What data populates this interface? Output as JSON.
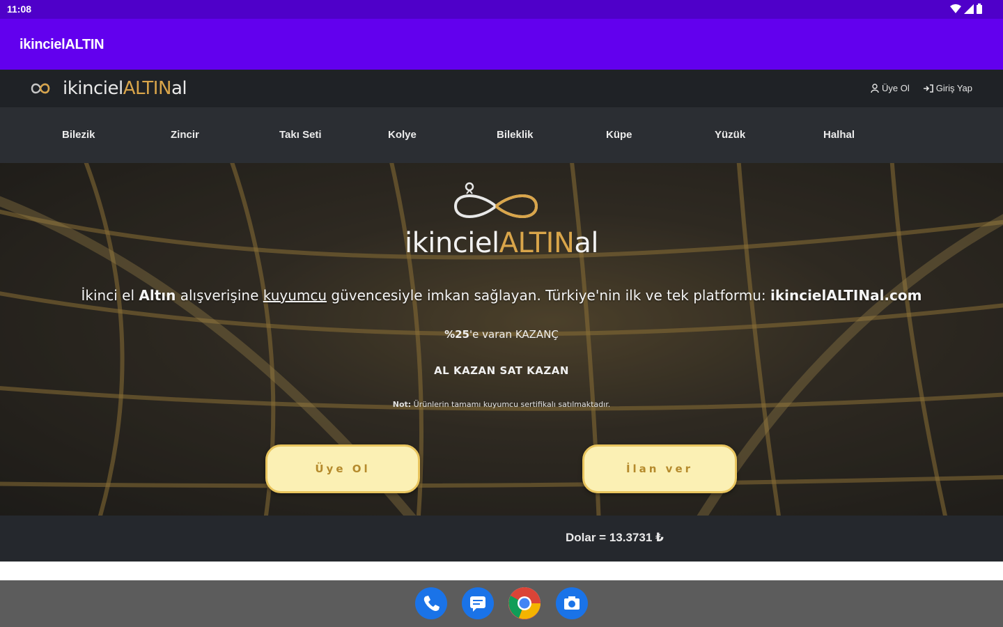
{
  "status_bar": {
    "time": "11:08"
  },
  "app_bar": {
    "title": "ikincielALTIN"
  },
  "site": {
    "logo": {
      "part1": "ikinciel",
      "part2": "ALTIN",
      "part3": "al"
    },
    "header_links": {
      "register": "Üye Ol",
      "login": "Giriş Yap"
    },
    "categories": [
      "Bilezik",
      "Zincir",
      "Takı Seti",
      "Kolye",
      "Bileklik",
      "Küpe",
      "Yüzük",
      "Halhal"
    ]
  },
  "hero": {
    "logo": {
      "part1": "ikinciel",
      "part2": "ALTIN",
      "part3": "al"
    },
    "headline": {
      "t1": "İkinci el ",
      "t2": "Altın",
      "t3": " alışverişine ",
      "t4": "kuyumcu",
      "t5": " güvencesiyle imkan sağlayan. Türkiye'nin ilk ve tek platformu: ",
      "t6": "ikincielALTINal.com"
    },
    "gain": {
      "bold": "%25",
      "rest": "'e varan KAZANÇ"
    },
    "slogan": "AL KAZAN SAT KAZAN",
    "note": {
      "label": "Not:",
      "text": " Ürünlerin tamamı kuyumcu sertifikalı satılmaktadır."
    },
    "buttons": {
      "register": "Üye Ol",
      "post_ad": "İlan ver"
    }
  },
  "rate": {
    "text": "Dolar = 13.3731 ₺"
  },
  "colors": {
    "status_bar": "#4f00c9",
    "app_bar": "#6200ee",
    "gold": "#d9a54a",
    "button_bg": "#fbf0b4"
  },
  "dock": {
    "icons": [
      "phone-icon",
      "messages-icon",
      "chrome-icon",
      "camera-icon"
    ]
  }
}
